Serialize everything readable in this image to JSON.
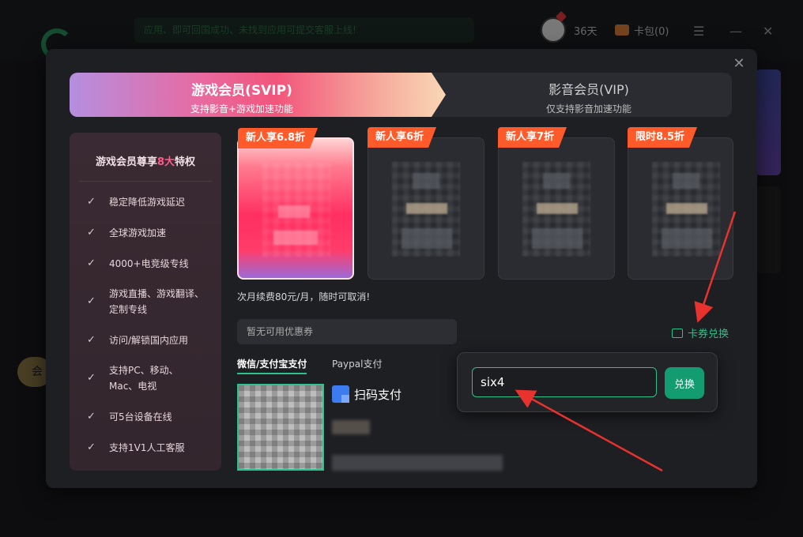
{
  "background": {
    "notice": "应用、即可回国成功、未找到应用可提交客服上线!",
    "days": "36天",
    "wallet_label": "卡包(0)"
  },
  "modal": {
    "tabs": [
      {
        "title": "游戏会员(SVIP)",
        "subtitle": "支持影音+游戏加速功能",
        "active": true
      },
      {
        "title": "影音会员(VIP)",
        "subtitle": "仅支持影音加速功能",
        "active": false
      }
    ],
    "privileges": {
      "title_prefix": "游戏会员尊享",
      "title_num": "8大",
      "title_suffix": "特权",
      "items": [
        "稳定降低游戏延迟",
        "全球游戏加速",
        "4000+电竞级专线",
        "游戏直播、游戏翻译、定制专线",
        "访问/解锁国内应用",
        "支持PC、移动、Mac、电视",
        "可5台设备在线",
        "支持1V1人工客服"
      ]
    },
    "packages": [
      {
        "badge": "新人享6.8折",
        "selected": true
      },
      {
        "badge": "新人享6折",
        "selected": false
      },
      {
        "badge": "新人享7折",
        "selected": false
      },
      {
        "badge": "限时8.5折",
        "selected": false
      }
    ],
    "renew_text": "次月续费80元/月，随时可取消!",
    "coupon_placeholder": "暂无可用优惠券",
    "redeem_link": "卡券兑换",
    "payment_tabs": [
      "微信/支付宝支付",
      "Paypal支付"
    ],
    "scan_pay": "扫码支付",
    "redeem_popup": {
      "input_value": "six4",
      "button": "兑换"
    }
  },
  "colors": {
    "accent": "#2cc08a",
    "badge": "#ff5a2a",
    "arrow": "#e8322e"
  }
}
